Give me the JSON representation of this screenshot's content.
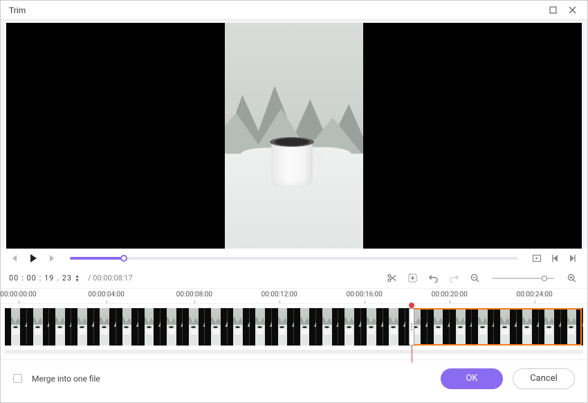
{
  "window": {
    "title": "Trim"
  },
  "timecode": {
    "current": "00 : 00 : 19 . 23",
    "duration": "/ 00:00:08:17"
  },
  "ruler": {
    "ticks": [
      "00:00:00:00",
      "00:00:04:00",
      "00:00:08:00",
      "00:00:12:00",
      "00:00:16:00",
      "00:00:20:00",
      "00:00:24:00"
    ],
    "positions_pct": [
      3,
      18,
      33,
      47.5,
      62,
      76.5,
      91
    ]
  },
  "playhead_pct": 70,
  "selection": {
    "start_pct": 70,
    "end_pct": 99
  },
  "progress_pct": 12,
  "footer": {
    "merge_label": "Merge into one file",
    "ok_label": "OK",
    "cancel_label": "Cancel"
  },
  "icons": {
    "maximize": "maximize-icon",
    "close": "close-icon"
  }
}
